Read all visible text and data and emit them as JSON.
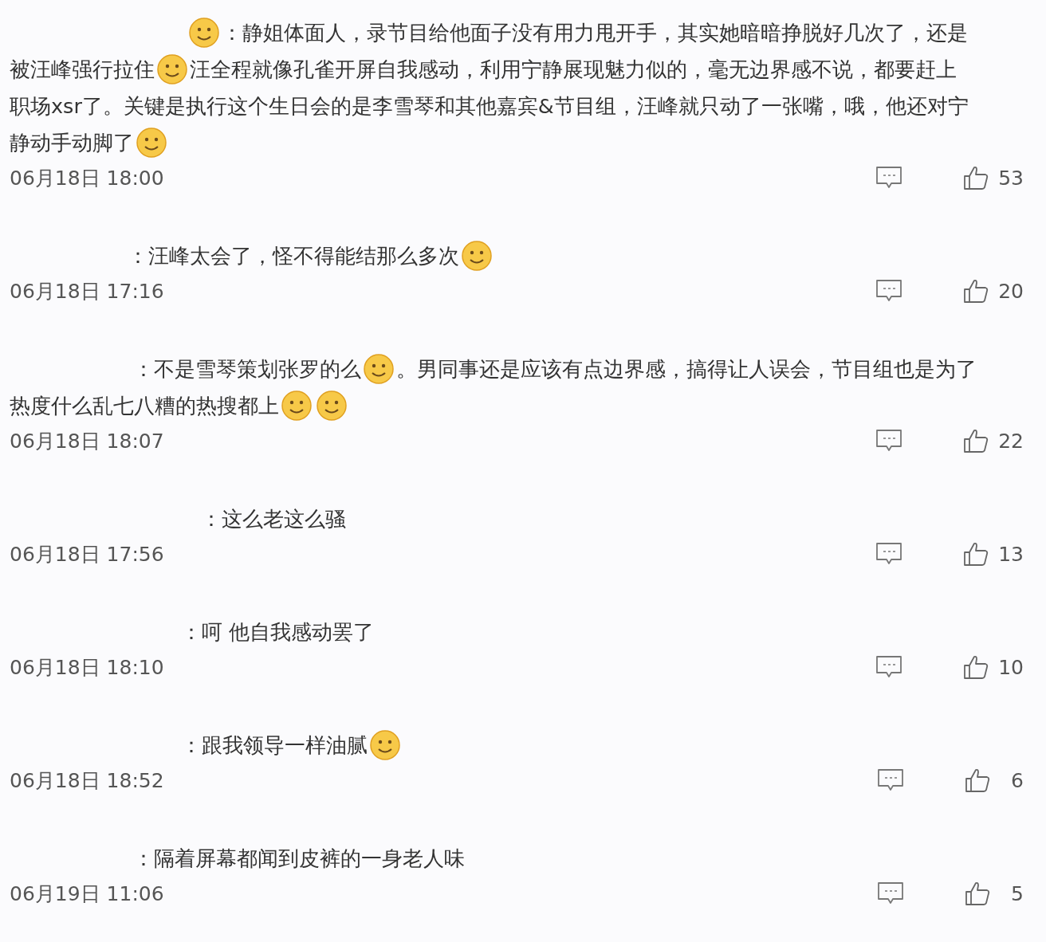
{
  "comments": [
    {
      "lines": [
        [
          {
            "kind": "emoji"
          },
          {
            "kind": "text",
            "text": "：静姐体面人，录节目给他面子没有用力甩开手，其实她暗暗挣脱好几次了，还是"
          }
        ],
        [
          {
            "kind": "text",
            "text": "被汪峰强行拉住"
          },
          {
            "kind": "emoji"
          },
          {
            "kind": "text",
            "text": "汪全程就像孔雀开屏自我感动，利用宁静展现魅力似的，毫无边界感不说，都要赶上"
          }
        ],
        [
          {
            "kind": "text",
            "text": "职场xsr了。关键是执行这个生日会的是李雪琴和其他嘉宾&节目组，汪峰就只动了一张嘴，哦，他还对宁"
          }
        ],
        [
          {
            "kind": "text",
            "text": "静动手动脚了"
          },
          {
            "kind": "emoji"
          }
        ]
      ],
      "date": "06月18日 18:00",
      "likes": "53"
    },
    {
      "lines": [
        [
          {
            "kind": "text",
            "text": "：汪峰太会了，怪不得能结那么多次"
          },
          {
            "kind": "emoji"
          }
        ]
      ],
      "date": "06月18日 17:16",
      "likes": "20"
    },
    {
      "lines": [
        [
          {
            "kind": "text",
            "text": "：不是雪琴策划张罗的么"
          },
          {
            "kind": "emoji"
          },
          {
            "kind": "text",
            "text": "。男同事还是应该有点边界感，搞得让人误会，节目组也是为了"
          }
        ],
        [
          {
            "kind": "text",
            "text": "热度什么乱七八糟的热搜都上"
          },
          {
            "kind": "emoji"
          },
          {
            "kind": "emoji"
          }
        ]
      ],
      "date": "06月18日 18:07",
      "likes": "22"
    },
    {
      "lines": [
        [
          {
            "kind": "text",
            "text": "：这么老这么骚"
          }
        ]
      ],
      "date": "06月18日 17:56",
      "likes": "13"
    },
    {
      "lines": [
        [
          {
            "kind": "text",
            "text": "：呵 他自我感动罢了"
          }
        ]
      ],
      "date": "06月18日 18:10",
      "likes": "10"
    },
    {
      "lines": [
        [
          {
            "kind": "text",
            "text": "：跟我领导一样油腻"
          },
          {
            "kind": "emoji"
          }
        ]
      ],
      "date": "06月18日 18:52",
      "likes": "6"
    },
    {
      "lines": [
        [
          {
            "kind": "text",
            "text": "：隔着屏幕都闻到皮裤的一身老人味"
          }
        ]
      ],
      "date": "06月19日 11:06",
      "likes": "5"
    }
  ]
}
